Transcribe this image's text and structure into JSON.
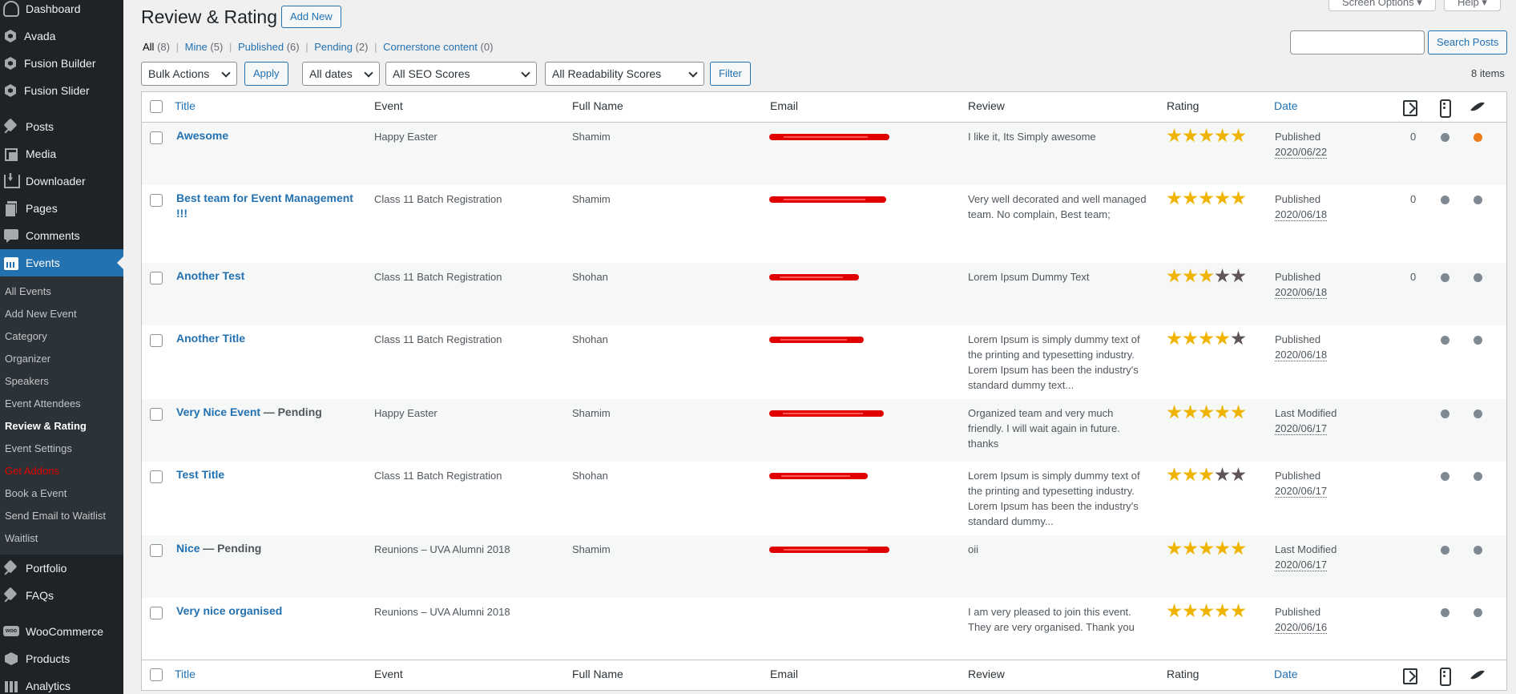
{
  "sidebar": {
    "top_items": [
      {
        "label": "Dashboard",
        "icon": "dashboard-icon"
      },
      {
        "label": "Avada",
        "icon": "avada-icon"
      },
      {
        "label": "Fusion Builder",
        "icon": "fusion-builder-icon"
      },
      {
        "label": "Fusion Slider",
        "icon": "fusion-slider-icon"
      }
    ],
    "mid_items": [
      {
        "label": "Posts",
        "icon": "pin-icon"
      },
      {
        "label": "Media",
        "icon": "media-icon"
      },
      {
        "label": "Downloader",
        "icon": "download-icon"
      },
      {
        "label": "Pages",
        "icon": "pages-icon"
      },
      {
        "label": "Comments",
        "icon": "comments-icon"
      }
    ],
    "events": {
      "label": "Events",
      "icon": "calendar-icon"
    },
    "submenu": [
      "All Events",
      "Add New Event",
      "Category",
      "Organizer",
      "Speakers",
      "Event Attendees",
      "Review & Rating",
      "Event Settings",
      "Get Addons",
      "Book a Event",
      "Send Email to Waitlist",
      "Waitlist"
    ],
    "bottom_items": [
      {
        "label": "Portfolio",
        "icon": "pin-icon"
      },
      {
        "label": "FAQs",
        "icon": "pin-icon"
      }
    ],
    "woo_items": [
      {
        "label": "WooCommerce",
        "icon": "woocommerce-icon"
      },
      {
        "label": "Products",
        "icon": "products-icon"
      },
      {
        "label": "Analytics",
        "icon": "analytics-icon"
      }
    ]
  },
  "header": {
    "title": "Review & Rating",
    "add_new": "Add New",
    "screen_options": "Screen Options ▾",
    "help": "Help ▾"
  },
  "filters_links": {
    "all": "All",
    "all_count": "(8)",
    "mine": "Mine",
    "mine_count": "(5)",
    "published": "Published",
    "published_count": "(6)",
    "pending": "Pending",
    "pending_count": "(2)",
    "cornerstone": "Cornerstone content",
    "cornerstone_count": "(0)",
    "sep": "|"
  },
  "search": {
    "button": "Search Posts",
    "value": ""
  },
  "toolbar": {
    "bulk_actions": "Bulk Actions",
    "apply": "Apply",
    "dates": "All dates",
    "seo": "All SEO Scores",
    "readability": "All Readability Scores",
    "filter": "Filter",
    "items_count": "8 items"
  },
  "columns": {
    "title": "Title",
    "event": "Event",
    "full_name": "Full Name",
    "email": "Email",
    "review": "Review",
    "rating": "Rating",
    "date": "Date"
  },
  "rows": [
    {
      "title": "Awesome",
      "state": "",
      "event": "Happy Easter",
      "name": "Shamim",
      "review": [
        "I like it, Its Simply awesome"
      ],
      "rating": 5,
      "status": "Published",
      "date": "2020/06/22",
      "links": "0",
      "seo_dot": "#7e8993",
      "read_dot": "#ee7c1b"
    },
    {
      "title": "Best team for Event Management !!!",
      "state": "",
      "event": "Class 11 Batch Registration",
      "name": "Shamim",
      "review": [
        "Very well decorated and well managed",
        "team. No complain, Best team;"
      ],
      "rating": 5,
      "status": "Published",
      "date": "2020/06/18",
      "links": "0",
      "seo_dot": "#7e8993",
      "read_dot": "#7e8993"
    },
    {
      "title": "Another Test",
      "state": "",
      "event": "Class 11 Batch Registration",
      "name": "Shohan",
      "review": [
        "Lorem Ipsum Dummy Text"
      ],
      "rating": 3,
      "status": "Published",
      "date": "2020/06/18",
      "links": "0",
      "seo_dot": "#7e8993",
      "read_dot": "#7e8993"
    },
    {
      "title": "Another Title",
      "state": "",
      "event": "Class 11 Batch Registration",
      "name": "Shohan",
      "review": [
        "Lorem Ipsum is simply dummy text of",
        "the printing and typesetting industry.",
        "Lorem Ipsum has been the industry's",
        "standard dummy text..."
      ],
      "rating": 4,
      "status": "Published",
      "date": "2020/06/18",
      "links": "",
      "seo_dot": "#7e8993",
      "read_dot": "#7e8993"
    },
    {
      "title": "Very Nice Event",
      "state": "— Pending",
      "event": "Happy Easter",
      "name": "Shamim",
      "review": [
        "Organized team and very much",
        "friendly. I will wait again in future.",
        "thanks"
      ],
      "rating": 5,
      "status": "Last Modified",
      "date": "2020/06/17",
      "links": "",
      "seo_dot": "#7e8993",
      "read_dot": "#7e8993"
    },
    {
      "title": "Test Title",
      "state": "",
      "event": "Class 11 Batch Registration",
      "name": "Shohan",
      "review": [
        "Lorem Ipsum is simply dummy text of",
        "the printing and typesetting industry.",
        "Lorem Ipsum has been the industry's",
        "standard dummy..."
      ],
      "rating": 3,
      "status": "Published",
      "date": "2020/06/17",
      "links": "",
      "seo_dot": "#7e8993",
      "read_dot": "#7e8993"
    },
    {
      "title": "Nice",
      "state": "— Pending",
      "event": "Reunions – UVA Alumni 2018",
      "name": "Shamim",
      "review": [
        "oii"
      ],
      "rating": 5,
      "status": "Last Modified",
      "date": "2020/06/17",
      "links": "",
      "seo_dot": "#7e8993",
      "read_dot": "#7e8993"
    },
    {
      "title": "Very nice organised",
      "state": "",
      "event": "Reunions – UVA Alumni 2018",
      "name": "",
      "review": [
        "I am very pleased to join this event.",
        "They are very organised. Thank you"
      ],
      "rating": 5,
      "status": "Published",
      "date": "2020/06/16",
      "links": "",
      "seo_dot": "#7e8993",
      "read_dot": "#7e8993"
    }
  ]
}
